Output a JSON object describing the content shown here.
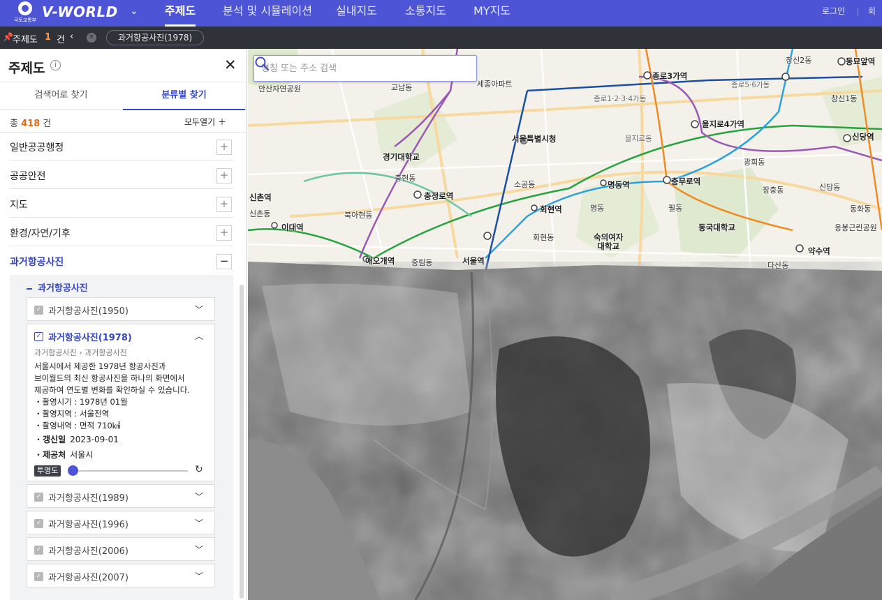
{
  "header": {
    "gov_text": "국토교통부",
    "brand": "V-WORLD",
    "menu": [
      "주제도",
      "분석 및 시뮬레이션",
      "실내지도",
      "소통지도",
      "MY지도"
    ],
    "login": "로그인",
    "join": "회원"
  },
  "layerbar": {
    "label": "주제도",
    "count": "1",
    "unit": "건",
    "collapse": "‹",
    "active_layer": "과거항공사진(1978)"
  },
  "sidebar": {
    "title": "주제도",
    "tabs": [
      "검색어로 찾기",
      "분류별 찾기"
    ],
    "total_prefix": "총",
    "total_count": "418",
    "total_unit": "건",
    "open_all": "모두열기 ＋",
    "categories": [
      "일반공공행정",
      "공공안전",
      "지도",
      "환경/자연/기후",
      "과거항공사진"
    ],
    "subgroup": "과거항공사진",
    "layers": [
      {
        "title": "과거항공사진(1950)"
      },
      {
        "title": "과거항공사진(1978)",
        "breadcrumb_a": "과거항공사진",
        "breadcrumb_b": "과거항공사진",
        "desc_lines": [
          "서울시에서 제공한 1978년 항공사진과",
          "브이월드의 최신 항공사진을 하나의 화면에서",
          "제공하여 연도별 변화를 확인하실 수 있습니다.",
          "・촬영시기 : 1978년 01월",
          "・촬영지역 : 서울전역",
          "・촬영내역 : 면적 710㎢"
        ],
        "updated_label": "갱신일",
        "updated": "2023-09-01",
        "provider_label": "제공처",
        "provider": "서울시",
        "opacity_label": "투명도",
        "opacity": 0
      },
      {
        "title": "과거항공사진(1989)"
      },
      {
        "title": "과거항공사진(1996)"
      },
      {
        "title": "과거항공사진(2006)"
      },
      {
        "title": "과거항공사진(2007)"
      }
    ]
  },
  "map": {
    "search_placeholder": "명칭 또는 주소 검색",
    "labels": {
      "ansan": "안산자연공원",
      "gyonam": "교남동",
      "sejong": "세종아파트",
      "jongno3": "종로3가역",
      "jongno1234": "종로1·2·3·4가동",
      "jongno56": "종로5·6가동",
      "changsin2": "창신2동",
      "dongmyo": "동묘앞역",
      "changsin1": "창신1동",
      "euljiro4": "을지로4가역",
      "euljiro_dong": "을지로동",
      "cityhall": "서울특별시청",
      "sindang": "신당역",
      "kyonggi": "경기대학교",
      "gwanghui": "광희동",
      "chunghyeon": "충현동",
      "sogong": "소공동",
      "myeongdong_st": "명동역",
      "chungmuro": "충무로역",
      "sinchon": "신촌역",
      "chungjeongno": "충정로역",
      "janchung": "장충동",
      "sindang_dong": "신당동",
      "hoehyeon_st": "회현역",
      "myeong": "명동",
      "pil": "필동",
      "dongguk": "동국대학교",
      "bukahyeon": "북아현동",
      "ewha": "이대역",
      "sinchon_dong": "신촌동",
      "hoehyeon": "회현동",
      "sookmyung": "숙의여자\n대학교",
      "eungbong": "응봉근린공원",
      "dongwha": "동화동",
      "aeogae": "애오개역",
      "junglim": "중림동",
      "seoul_st": "서울역",
      "yaksu": "약수역",
      "dasan": "다산동"
    }
  }
}
